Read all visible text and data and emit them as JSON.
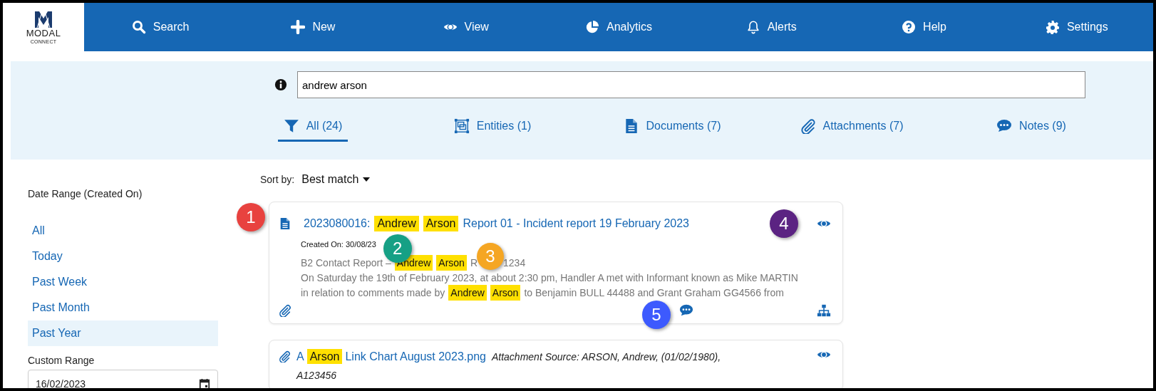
{
  "logo": {
    "name": "MODAL",
    "sub": "CONNECT"
  },
  "nav": [
    {
      "label": "Search"
    },
    {
      "label": "New"
    },
    {
      "label": "View"
    },
    {
      "label": "Analytics"
    },
    {
      "label": "Alerts"
    },
    {
      "label": "Help"
    },
    {
      "label": "Settings"
    }
  ],
  "search": {
    "value": "andrew arson"
  },
  "tabs": [
    {
      "label": "All (24)",
      "selected": true
    },
    {
      "label": "Entities (1)",
      "selected": false
    },
    {
      "label": "Documents (7)",
      "selected": false
    },
    {
      "label": "Attachments (7)",
      "selected": false
    },
    {
      "label": "Notes (9)",
      "selected": false
    }
  ],
  "sidebar": {
    "heading": "Date Range (Created On)",
    "items": [
      {
        "label": "All",
        "selected": false
      },
      {
        "label": "Today",
        "selected": false
      },
      {
        "label": "Past Week",
        "selected": false
      },
      {
        "label": "Past Month",
        "selected": false
      },
      {
        "label": "Past Year",
        "selected": true
      }
    ],
    "custom_range": {
      "label": "Custom Range",
      "value": "16/02/2023"
    }
  },
  "sort": {
    "label": "Sort by:",
    "value": "Best match"
  },
  "results": [
    {
      "kind": "document",
      "title": [
        {
          "text": "2023080016:",
          "highlight": false
        },
        {
          "text": "Andrew",
          "highlight": true
        },
        {
          "text": "Arson",
          "highlight": true
        },
        {
          "text": "Report 01 - Incident report 19 February 2023",
          "highlight": false
        }
      ],
      "created": "Created On: 30/08/23",
      "snippet": [
        [
          {
            "text": "B2 Contact Report –",
            "highlight": false
          },
          {
            "text": "Andrew",
            "highlight": true
          },
          {
            "text": "Arson",
            "highlight": true
          },
          {
            "text": "R",
            "highlight": false
          },
          {
            "text": "1234",
            "highlight": false
          }
        ],
        [
          {
            "text": "On Saturday the 19th of February 2023, at about 2:30 pm, Handler A met with Informant known as Mike MARTIN",
            "highlight": false
          }
        ],
        [
          {
            "text": "in relation to comments made by",
            "highlight": false
          },
          {
            "text": "Andrew",
            "highlight": true
          },
          {
            "text": "Arson",
            "highlight": true
          },
          {
            "text": "to Benjamin BULL 44488 and Grant Graham GG4566 from",
            "highlight": false
          }
        ]
      ]
    },
    {
      "kind": "attachment",
      "title": [
        {
          "text": "A",
          "highlight": false
        },
        {
          "text": "Arson",
          "highlight": true
        },
        {
          "text": "Link Chart August 2023.png",
          "highlight": false
        }
      ],
      "source": [
        "Attachment Source: ARSON, Andrew, (01/02/1980),",
        "A123456"
      ]
    }
  ],
  "callouts": [
    {
      "number": "1",
      "color": "#e8423f"
    },
    {
      "number": "2",
      "color": "#16a085"
    },
    {
      "number": "3",
      "color": "#f5a623"
    },
    {
      "number": "4",
      "color": "#5b2382"
    },
    {
      "number": "5",
      "color": "#3d5afe"
    }
  ]
}
